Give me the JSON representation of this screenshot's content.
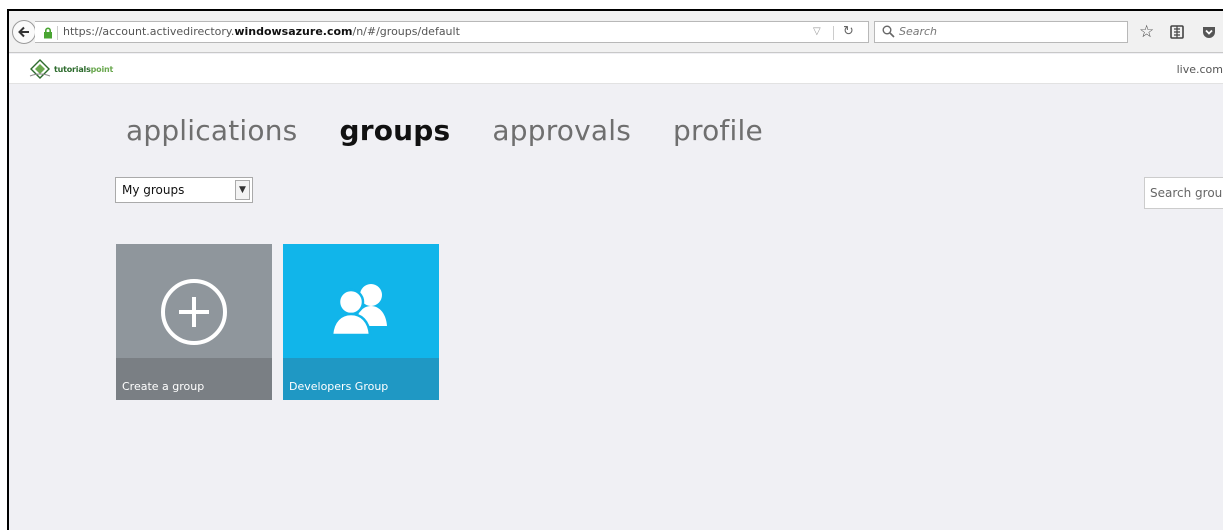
{
  "browser": {
    "url_prefix": "https://account.activedirectory.",
    "url_domain": "windowsazure.com",
    "url_suffix": "/n/#/groups/default",
    "search_placeholder": "Search"
  },
  "header": {
    "logo_text_1": "tutorials",
    "logo_text_2": "point",
    "account_text": "live.com"
  },
  "nav": {
    "tabs": [
      {
        "label": "applications",
        "active": false
      },
      {
        "label": "groups",
        "active": true
      },
      {
        "label": "approvals",
        "active": false
      },
      {
        "label": "profile",
        "active": false
      }
    ]
  },
  "filter": {
    "selected": "My groups",
    "search_placeholder": "Search groups"
  },
  "tiles": [
    {
      "label": "Create a group",
      "icon": "plus-circle-icon",
      "color": "#8f969c"
    },
    {
      "label": "Developers Group",
      "icon": "users-icon",
      "color": "#11b5ea"
    }
  ]
}
